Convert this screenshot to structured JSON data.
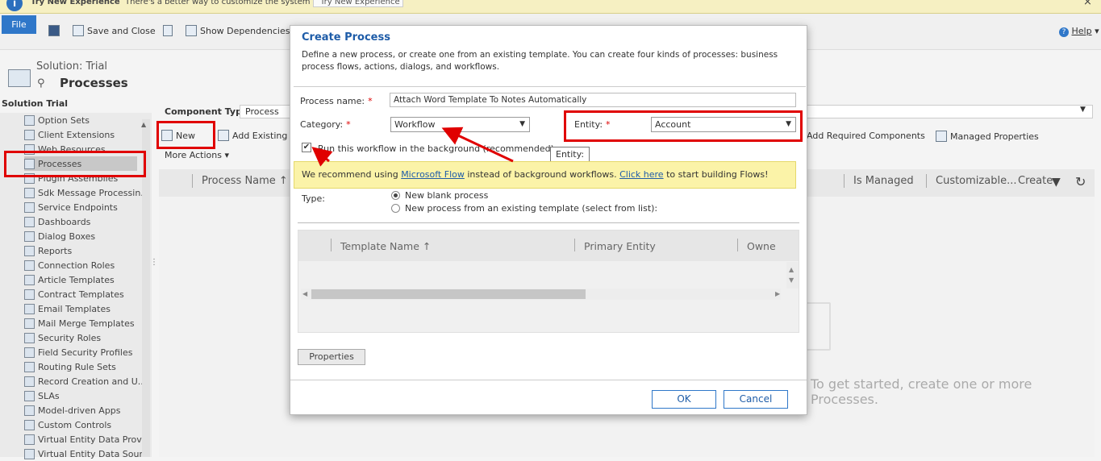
{
  "notification": {
    "title": "Try New Experience",
    "text": "There's a better way to customize the system",
    "button": "Try New Experience",
    "close": "×"
  },
  "ribbon": {
    "file": "File",
    "save_close": "Save and Close",
    "show_dependencies": "Show Dependencies",
    "help": "Help"
  },
  "solution": {
    "subtitle": "Solution: Trial",
    "title": "Processes",
    "root": "Solution Trial"
  },
  "nav": {
    "items": [
      {
        "label": "Option Sets",
        "icon": "option-sets-icon"
      },
      {
        "label": "Client Extensions",
        "icon": "client-extensions-icon"
      },
      {
        "label": "Web Resources",
        "icon": "web-resources-icon"
      },
      {
        "label": "Processes",
        "icon": "processes-icon"
      },
      {
        "label": "Plugin Assemblies",
        "icon": "plugin-assemblies-icon"
      },
      {
        "label": "Sdk Message Processin...",
        "icon": "sdk-message-icon"
      },
      {
        "label": "Service Endpoints",
        "icon": "service-endpoints-icon"
      },
      {
        "label": "Dashboards",
        "icon": "dashboards-icon"
      },
      {
        "label": "Dialog Boxes",
        "icon": "dialog-boxes-icon"
      },
      {
        "label": "Reports",
        "icon": "reports-icon"
      },
      {
        "label": "Connection Roles",
        "icon": "connection-roles-icon"
      },
      {
        "label": "Article Templates",
        "icon": "article-templates-icon"
      },
      {
        "label": "Contract Templates",
        "icon": "contract-templates-icon"
      },
      {
        "label": "Email Templates",
        "icon": "email-templates-icon"
      },
      {
        "label": "Mail Merge Templates",
        "icon": "mail-merge-icon"
      },
      {
        "label": "Security Roles",
        "icon": "security-roles-icon"
      },
      {
        "label": "Field Security Profiles",
        "icon": "field-security-icon"
      },
      {
        "label": "Routing Rule Sets",
        "icon": "routing-rule-icon"
      },
      {
        "label": "Record Creation and U...",
        "icon": "record-creation-icon"
      },
      {
        "label": "SLAs",
        "icon": "slas-icon"
      },
      {
        "label": "Model-driven Apps",
        "icon": "model-driven-apps-icon"
      },
      {
        "label": "Custom Controls",
        "icon": "custom-controls-icon"
      },
      {
        "label": "Virtual Entity Data Prov...",
        "icon": "virtual-entity-provider-icon"
      },
      {
        "label": "Virtual Entity Data Sour...",
        "icon": "virtual-entity-source-icon"
      }
    ]
  },
  "main": {
    "component_type_label": "Component Type",
    "component_type_value": "Process",
    "new": "New",
    "add_existing": "Add Existing",
    "more_actions": "More Actions",
    "add_required": "Add Required Components",
    "managed_properties": "Managed Properties",
    "col_process_name": "Process Name ↑",
    "col_is_managed": "Is Managed",
    "col_customizable": "Customizable...",
    "col_create": "Create",
    "empty_message": "To get started, create one or more Processes."
  },
  "dialog": {
    "title": "Create Process",
    "description": "Define a new process, or create one from an existing template. You can create four kinds of processes: business process flows, actions, dialogs, and workflows.",
    "process_name_label": "Process name:",
    "process_name_value": "Attach Word Template To Notes Automatically",
    "category_label": "Category:",
    "category_value": "Workflow",
    "entity_label": "Entity:",
    "entity_value": "Account",
    "background_label": "Run this workflow in the background (recommended)",
    "tooltip": "Entity:",
    "banner_pre": "We recommend using ",
    "banner_link1": "Microsoft Flow",
    "banner_mid": " instead of background workflows. ",
    "banner_link2": "Click here",
    "banner_post": " to start building Flows!",
    "type_label": "Type:",
    "type_option1": "New blank process",
    "type_option2": "New process from an existing template (select from list):",
    "tmpl_col1": "Template Name ↑",
    "tmpl_col2": "Primary Entity",
    "tmpl_col3": "Owne",
    "properties": "Properties",
    "ok": "OK",
    "cancel": "Cancel"
  },
  "colors": {
    "accent": "#1e5ca8",
    "file_button": "#2f77c9",
    "annotation": "#e00000",
    "banner": "#fbf3a8"
  }
}
